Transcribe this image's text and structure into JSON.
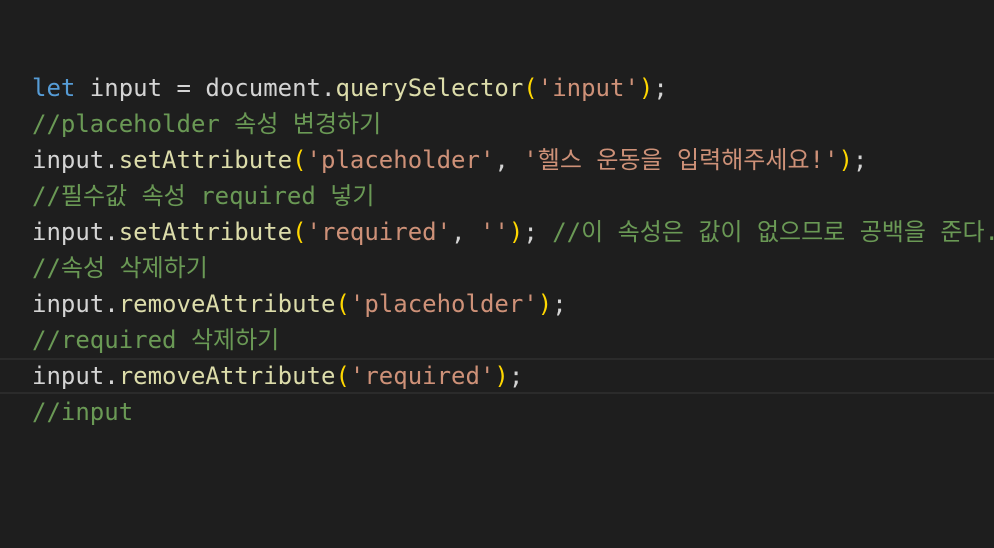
{
  "editor": {
    "theme": {
      "background": "#1e1e1e",
      "current_line_border": "#2b2b2b"
    },
    "colors": {
      "keyword": "#569cd6",
      "identifier": "#d4d4d4",
      "function": "#dcdcaa",
      "string": "#ce9178",
      "bracket": "#ffd700",
      "comment": "#6a9955"
    },
    "current_line": 8,
    "lines": [
      [
        {
          "t": "let",
          "c": "kw"
        },
        {
          "t": " input = document.",
          "c": "id"
        },
        {
          "t": "querySelector",
          "c": "fn"
        },
        {
          "t": "(",
          "c": "paren"
        },
        {
          "t": "'input'",
          "c": "str"
        },
        {
          "t": ")",
          "c": "paren"
        },
        {
          "t": ";",
          "c": "punc"
        }
      ],
      [
        {
          "t": "//placeholder 속성 변경하기",
          "c": "cm"
        }
      ],
      [
        {
          "t": "input.",
          "c": "id"
        },
        {
          "t": "setAttribute",
          "c": "fn"
        },
        {
          "t": "(",
          "c": "paren"
        },
        {
          "t": "'placeholder'",
          "c": "str"
        },
        {
          "t": ", ",
          "c": "punc"
        },
        {
          "t": "'헬스 운동을 입력해주세요!'",
          "c": "str"
        },
        {
          "t": ")",
          "c": "paren"
        },
        {
          "t": ";",
          "c": "punc"
        }
      ],
      [
        {
          "t": "//필수값 속성 required 넣기",
          "c": "cm"
        }
      ],
      [
        {
          "t": "input.",
          "c": "id"
        },
        {
          "t": "setAttribute",
          "c": "fn"
        },
        {
          "t": "(",
          "c": "paren"
        },
        {
          "t": "'required'",
          "c": "str"
        },
        {
          "t": ", ",
          "c": "punc"
        },
        {
          "t": "''",
          "c": "str"
        },
        {
          "t": ")",
          "c": "paren"
        },
        {
          "t": "; ",
          "c": "punc"
        },
        {
          "t": "//이 속성은 값이 없으므로 공백을 준다.",
          "c": "cm"
        }
      ],
      [
        {
          "t": "//속성 삭제하기",
          "c": "cm"
        }
      ],
      [
        {
          "t": "input.",
          "c": "id"
        },
        {
          "t": "removeAttribute",
          "c": "fn"
        },
        {
          "t": "(",
          "c": "paren"
        },
        {
          "t": "'placeholder'",
          "c": "str"
        },
        {
          "t": ")",
          "c": "paren"
        },
        {
          "t": ";",
          "c": "punc"
        }
      ],
      [
        {
          "t": "//required 삭제하기",
          "c": "cm"
        }
      ],
      [
        {
          "t": "input.",
          "c": "id"
        },
        {
          "t": "removeAttribute",
          "c": "fn"
        },
        {
          "t": "(",
          "c": "paren"
        },
        {
          "t": "'required'",
          "c": "str"
        },
        {
          "t": ")",
          "c": "paren"
        },
        {
          "t": ";",
          "c": "punc"
        }
      ],
      [
        {
          "t": "//input",
          "c": "cm"
        }
      ]
    ]
  }
}
